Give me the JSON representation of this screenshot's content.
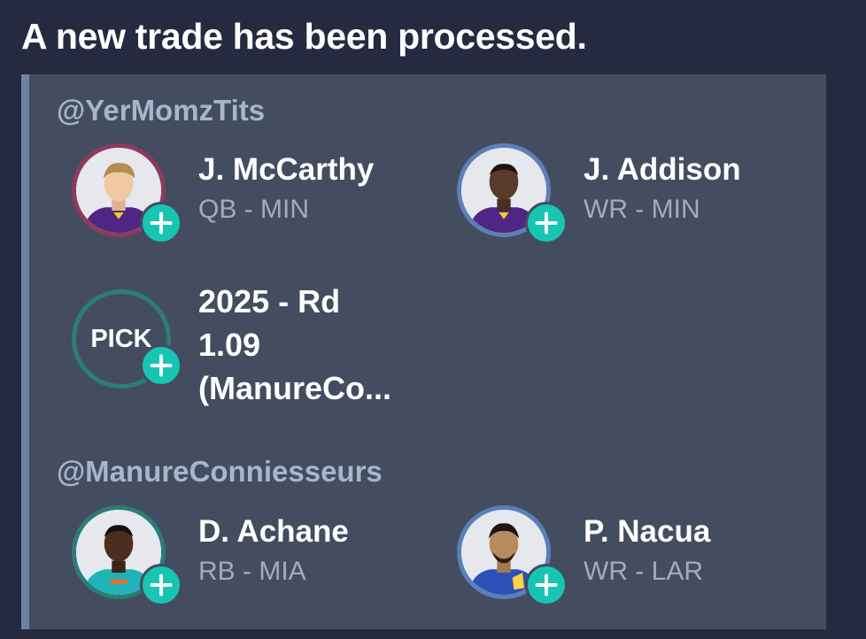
{
  "header": {
    "title": "A new trade has been processed."
  },
  "teams": [
    {
      "handle": "@YerMomzTits",
      "assets": [
        {
          "name": "J. McCarthy",
          "position": "QB - MIN",
          "ring_color": "#8e3a5f",
          "jersey_color": "#4f2683"
        },
        {
          "name": "J. Addison",
          "position": "WR - MIN",
          "ring_color": "#5b7fb8",
          "jersey_color": "#4f2683"
        },
        {
          "pick_badge": "PICK",
          "pick_line1": "2025 - Rd",
          "pick_line2": "1.09",
          "pick_line3": "(ManureCo..."
        }
      ]
    },
    {
      "handle": "@ManureConniesseurs",
      "assets": [
        {
          "name": "D. Achane",
          "position": "RB - MIA",
          "ring_color": "#2b7d77",
          "jersey_color": "#1fb3b7"
        },
        {
          "name": "P. Nacua",
          "position": "WR - LAR",
          "ring_color": "#5b7fb8",
          "jersey_color": "#2d4fb8"
        }
      ]
    }
  ],
  "colors": {
    "background": "#262a40",
    "card": "#434d5f",
    "accent_bar": "#6d83a6",
    "add_badge": "#18c5b3"
  },
  "icons": {
    "add": "plus-circle-icon",
    "player_photo": "player-headshot-icon"
  }
}
